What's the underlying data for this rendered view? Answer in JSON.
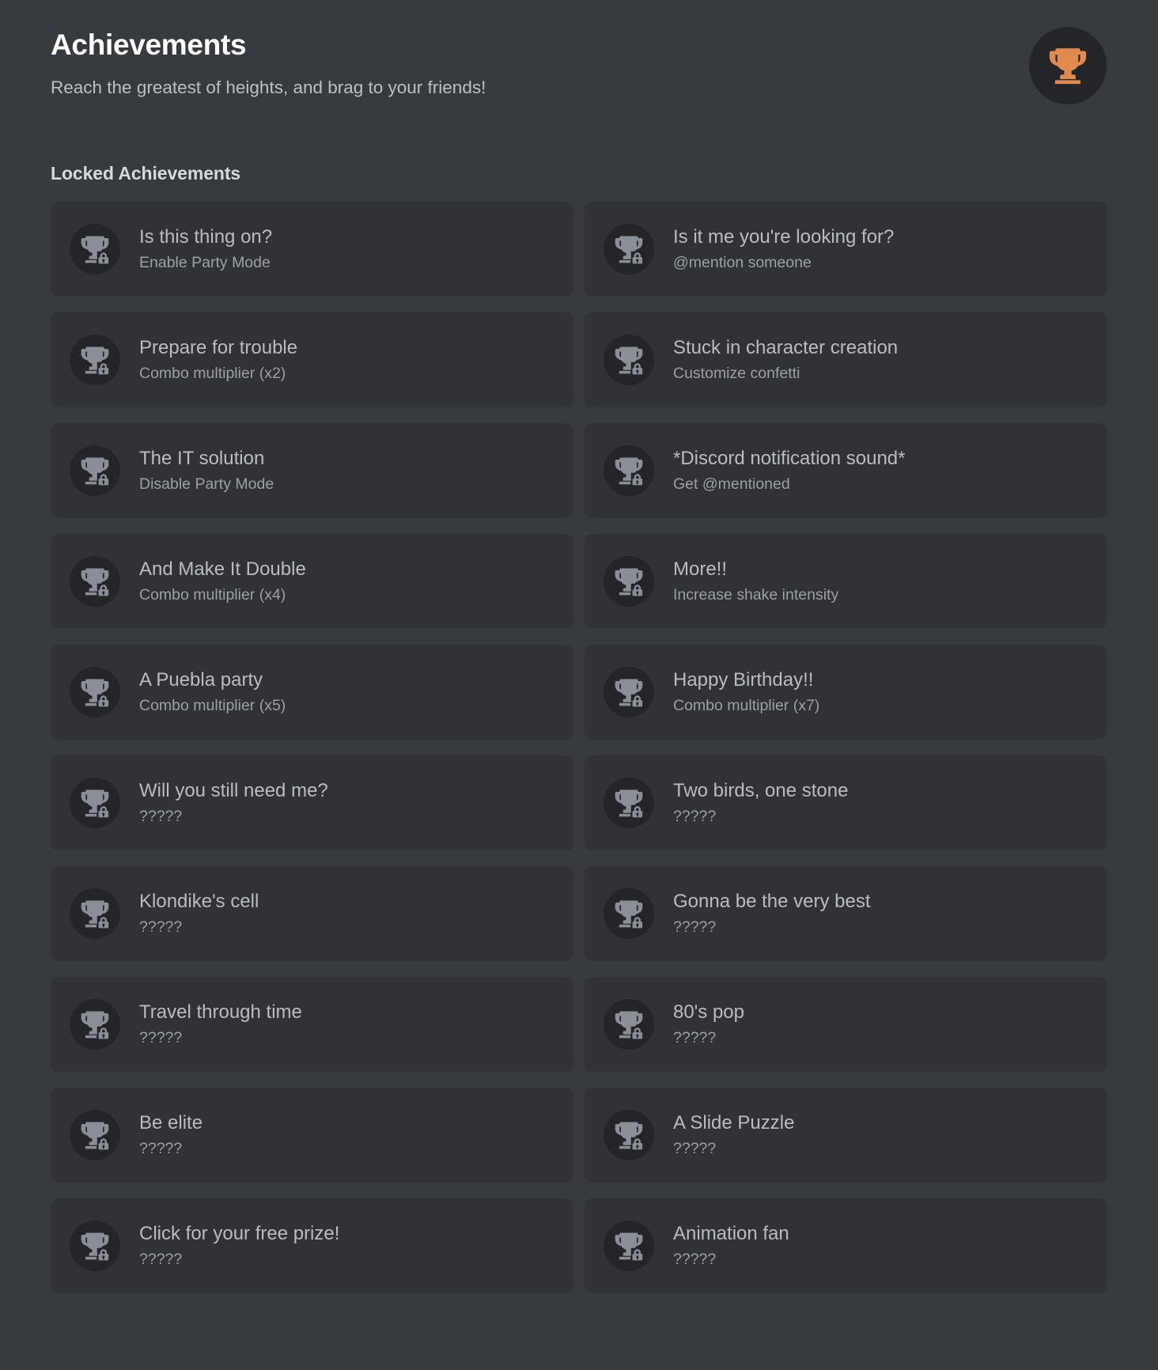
{
  "header": {
    "title": "Achievements",
    "subtitle": "Reach the greatest of heights, and brag to your friends!",
    "badge_icon": "trophy-icon",
    "badge_color": "#e08a50",
    "badge_bg": "#232529"
  },
  "theme": {
    "page_bg": "#373a3f",
    "card_bg": "#303236",
    "icon_bg": "#232529",
    "trophy_locked_color": "#8a8e95",
    "title_color": "#ffffff",
    "subtitle_color": "#bcc0c5",
    "card_title_color": "#b9bdc2",
    "card_desc_color": "#9ba0a6"
  },
  "section": {
    "title": "Locked Achievements"
  },
  "achievements": [
    {
      "title": "Is this thing on?",
      "desc": "Enable Party Mode",
      "icon": "trophy-locked-icon"
    },
    {
      "title": "Is it me you're looking for?",
      "desc": "@mention someone",
      "icon": "trophy-locked-icon"
    },
    {
      "title": "Prepare for trouble",
      "desc": "Combo multiplier (x2)",
      "icon": "trophy-locked-icon"
    },
    {
      "title": "Stuck in character creation",
      "desc": "Customize confetti",
      "icon": "trophy-locked-icon"
    },
    {
      "title": "The IT solution",
      "desc": "Disable Party Mode",
      "icon": "trophy-locked-icon"
    },
    {
      "title": "*Discord notification sound*",
      "desc": "Get @mentioned",
      "icon": "trophy-locked-icon"
    },
    {
      "title": "And Make It Double",
      "desc": "Combo multiplier (x4)",
      "icon": "trophy-locked-icon"
    },
    {
      "title": "More!!",
      "desc": "Increase shake intensity",
      "icon": "trophy-locked-icon"
    },
    {
      "title": "A Puebla party",
      "desc": "Combo multiplier (x5)",
      "icon": "trophy-locked-icon"
    },
    {
      "title": "Happy Birthday!!",
      "desc": "Combo multiplier (x7)",
      "icon": "trophy-locked-icon"
    },
    {
      "title": "Will you still need me?",
      "desc": "?????",
      "icon": "trophy-locked-icon"
    },
    {
      "title": "Two birds, one stone",
      "desc": "?????",
      "icon": "trophy-locked-icon"
    },
    {
      "title": "Klondike's cell",
      "desc": "?????",
      "icon": "trophy-locked-icon"
    },
    {
      "title": "Gonna be the very best",
      "desc": "?????",
      "icon": "trophy-locked-icon"
    },
    {
      "title": "Travel through time",
      "desc": "?????",
      "icon": "trophy-locked-icon"
    },
    {
      "title": "80's pop",
      "desc": "?????",
      "icon": "trophy-locked-icon"
    },
    {
      "title": "Be elite",
      "desc": "?????",
      "icon": "trophy-locked-icon"
    },
    {
      "title": "A Slide Puzzle",
      "desc": "?????",
      "icon": "trophy-locked-icon"
    },
    {
      "title": "Click for your free prize!",
      "desc": "?????",
      "icon": "trophy-locked-icon"
    },
    {
      "title": "Animation fan",
      "desc": "?????",
      "icon": "trophy-locked-icon"
    }
  ]
}
